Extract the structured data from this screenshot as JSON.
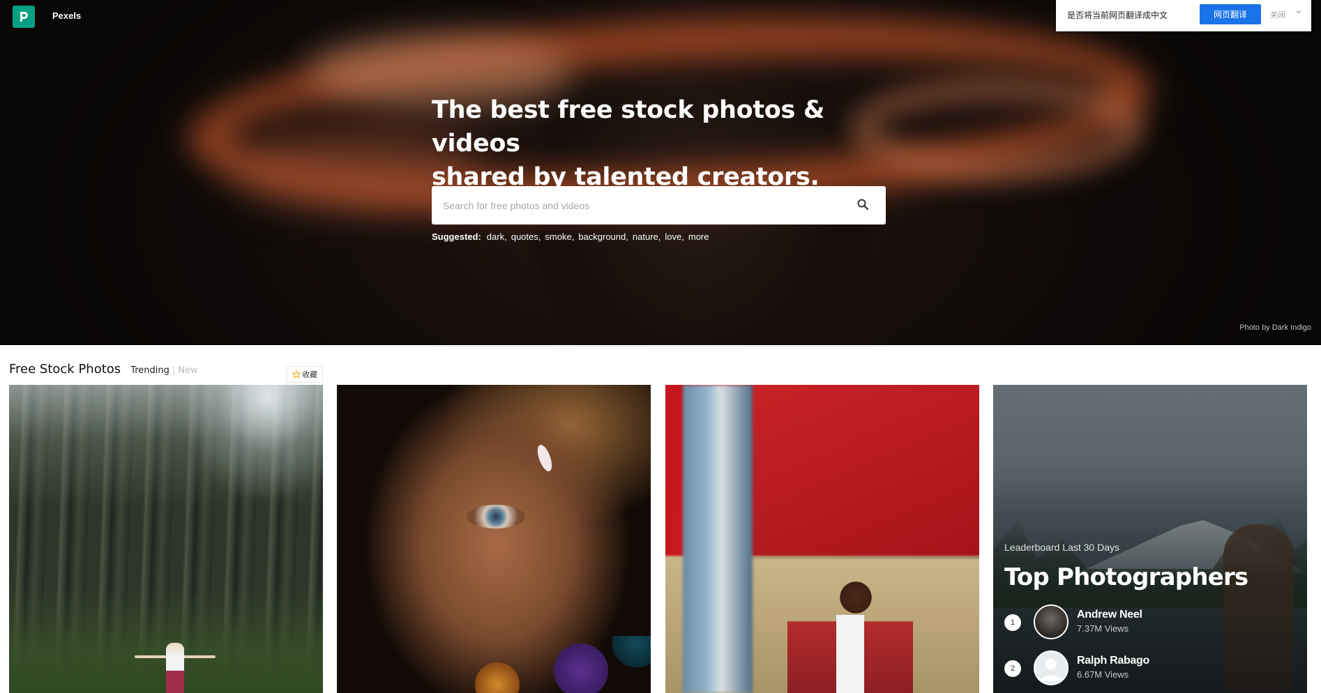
{
  "brand": {
    "name": "Pexels"
  },
  "translate_bar": {
    "message": "是否将当前网页翻译成中文",
    "translate_button": "网页翻译",
    "close_label": "关闭"
  },
  "hero": {
    "headline_line1": "The best free stock photos & videos",
    "headline_line2": "shared by talented creators.",
    "search_placeholder": "Search for free photos and videos",
    "suggested_label": "Suggested:",
    "suggestions": [
      "dark",
      "quotes",
      "smoke",
      "background",
      "nature",
      "love",
      "more"
    ],
    "photo_credit": "Photo by Dark Indigo"
  },
  "section": {
    "title": "Free Stock Photos",
    "tab_trending": "Trending",
    "tab_separator": "|",
    "tab_new": "New",
    "favorite_label": "收藏"
  },
  "leaderboard": {
    "subtitle": "Leaderboard Last 30 Days",
    "title": "Top Photographers",
    "entries": [
      {
        "rank": "1",
        "name": "Andrew Neel",
        "views": "7.37M Views"
      },
      {
        "rank": "2",
        "name": "Ralph Rabago",
        "views": "6.67M Views"
      }
    ]
  },
  "colors": {
    "brand_green": "#05a081",
    "translate_blue": "#1a73e8"
  }
}
